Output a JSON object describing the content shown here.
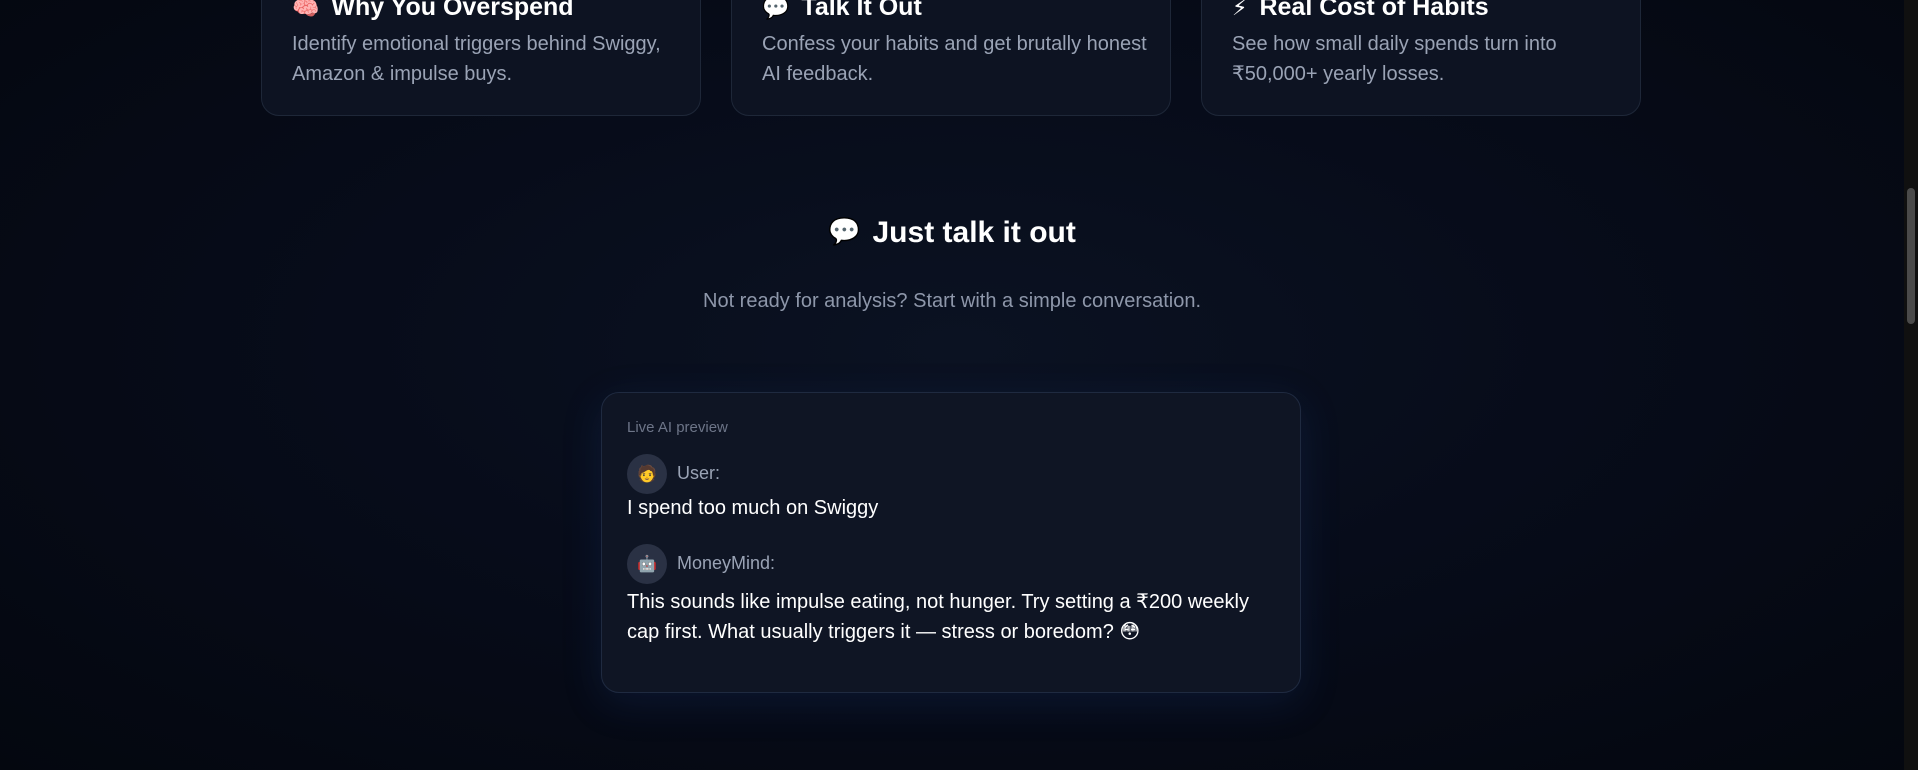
{
  "features": [
    {
      "icon": "brain-icon",
      "glyph": "🧠",
      "color": "#f472b6",
      "title": "Why You Overspend",
      "text": "Identify emotional triggers behind Swiggy, Amazon & impulse buys."
    },
    {
      "icon": "speech-bubble-icon",
      "glyph": "💬",
      "color": "#e5e7eb",
      "title": "Talk It Out",
      "text": "Confess your habits and get brutally honest AI feedback."
    },
    {
      "icon": "lightning-icon",
      "glyph": "⚡",
      "color": "#ef4444",
      "title": "Real Cost of Habits",
      "text": "See how small daily spends turn into ₹50,000+ yearly losses."
    }
  ],
  "talk_section": {
    "icon": "speech-bubble-icon",
    "glyph": "💬",
    "title": "Just talk it out",
    "subtitle": "Not ready for analysis? Start with a simple conversation."
  },
  "chat_preview": {
    "label": "Live AI preview",
    "messages": [
      {
        "speaker": "User:",
        "avatar": "user-avatar-icon",
        "avatar_glyph": "🧑",
        "text": "I spend too much on Swiggy"
      },
      {
        "speaker": "MoneyMind:",
        "avatar": "robot-avatar-icon",
        "avatar_glyph": "🤖",
        "text": "This sounds like impulse eating, not hunger. Try setting a ₹200 weekly cap first. What usually triggers it — stress or boredom? 😳"
      }
    ]
  },
  "colors": {
    "background": "#060b18",
    "card": "#0d1322",
    "border": "#1e2738",
    "muted_text": "#9aa3b5"
  }
}
